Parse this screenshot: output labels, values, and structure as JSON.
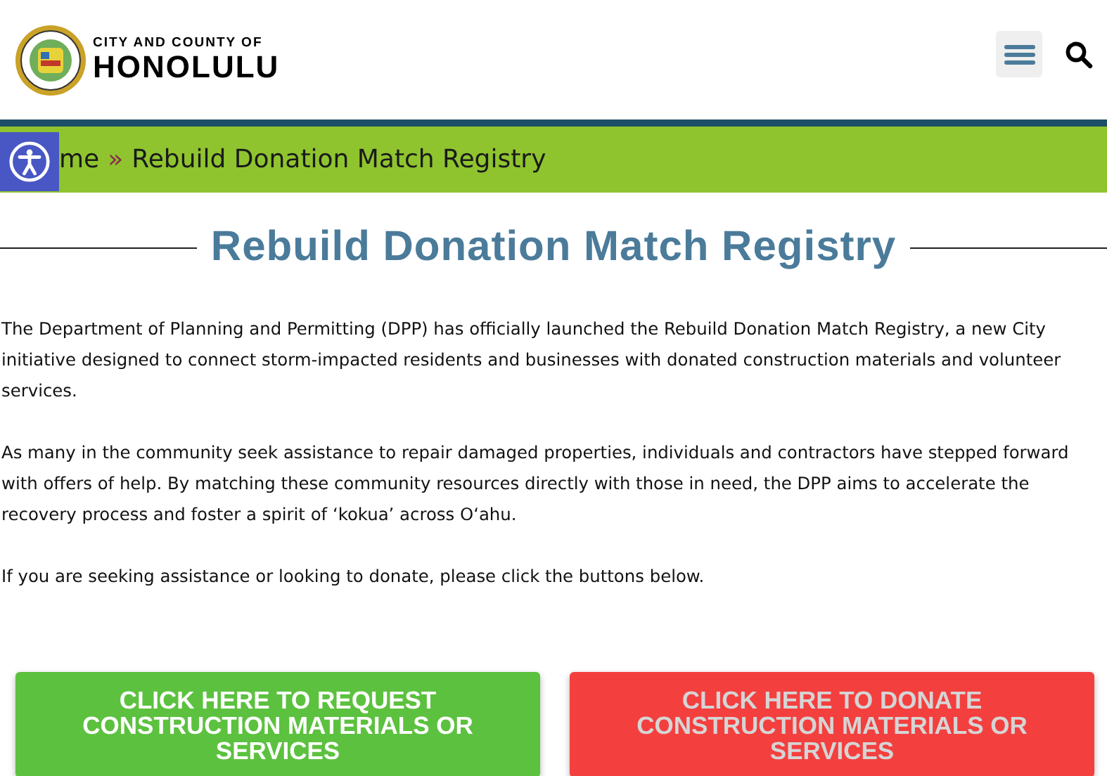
{
  "header": {
    "logo_small": "CITY AND COUNTY OF",
    "logo_big": "HONOLULU"
  },
  "breadcrumb": {
    "link": "me",
    "separator": "»",
    "current": "Rebuild Donation Match Registry"
  },
  "title": "Rebuild Donation Match Registry",
  "paragraphs": [
    "The Department of Planning and Permitting (DPP) has officially launched the Rebuild Donation Match Registry, a new City initiative designed to connect storm-impacted residents and businesses with donated construction materials and volunteer services.",
    "As many in the community seek assistance to repair damaged properties, individuals and contractors have stepped forward with offers of help. By matching these community resources directly with those in need, the DPP aims to accelerate the recovery process and foster a spirit of ‘kokua’ across O‘ahu.",
    "If you are seeking assistance or looking to donate, please click the buttons below."
  ],
  "buttons": [
    {
      "label": "CLICK HERE TO REQUEST CONSTRUCTION MATERIALS OR SERVICES",
      "kind": "request",
      "color": "#5cc13f"
    },
    {
      "label": "CLICK HERE TO DONATE CONSTRUCTION MATERIALS OR SERVICES",
      "kind": "donate",
      "color": "#f43f3f"
    }
  ]
}
